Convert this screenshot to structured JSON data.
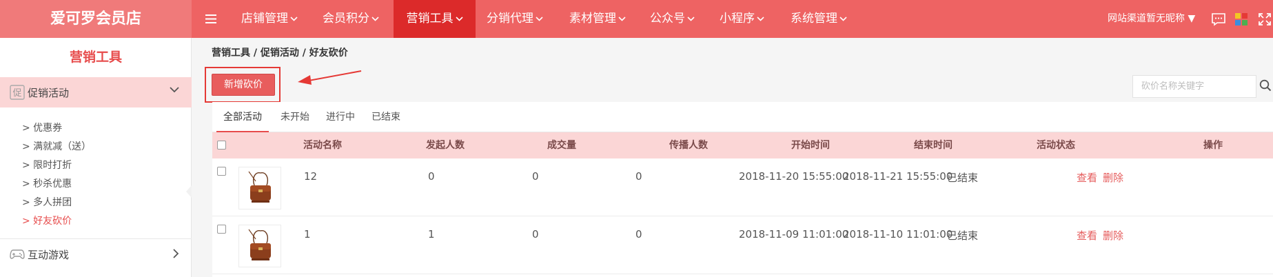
{
  "brand": "爱可罗会员店",
  "nav": {
    "items": [
      "店铺管理",
      "会员积分",
      "营销工具",
      "分销代理",
      "素材管理",
      "公众号",
      "小程序",
      "系统管理"
    ],
    "active_index": 2,
    "site_label": "网站渠道暂无昵称",
    "site_caret": "▼"
  },
  "sidebar": {
    "title": "营销工具",
    "groups": [
      {
        "label": "促销活动",
        "icon": "促",
        "expanded": true
      },
      {
        "label": "互动游戏",
        "expanded": false
      }
    ],
    "items": [
      "> 优惠券",
      "> 满就减（送）",
      "> 限时打折",
      "> 秒杀优惠",
      "> 多人拼团",
      "> 好友砍价"
    ],
    "active_item_index": 5
  },
  "main": {
    "breadcrumb": "营销工具 / 促销活动 / 好友砍价",
    "add_button_label": "新增砍价",
    "search_placeholder": "砍价名称关键字",
    "tabs": [
      "全部活动",
      "未开始",
      "进行中",
      "已结束"
    ],
    "active_tab_index": 0,
    "columns": [
      "活动名称",
      "发起人数",
      "成交量",
      "传播人数",
      "开始时间",
      "结束时间",
      "活动状态",
      "操作"
    ],
    "rows": [
      {
        "name": "12",
        "initiators": "0",
        "deals": "0",
        "spread": "0",
        "start": "2018-11-20 15:55:00",
        "end": "2018-11-21 15:55:00",
        "status": "已结束",
        "view": "查看",
        "delete": "删除"
      },
      {
        "name": "1",
        "initiators": "1",
        "deals": "0",
        "spread": "0",
        "start": "2018-11-09 11:01:00",
        "end": "2018-11-10 11:01:00",
        "status": "已结束",
        "view": "查看",
        "delete": "删除"
      }
    ]
  },
  "colors": {
    "topbar": "#ee6363",
    "active_nav": "#dc2a2a",
    "accent": "#e74c4c",
    "table_header": "#fbd6d6",
    "callout": "#e53935"
  }
}
